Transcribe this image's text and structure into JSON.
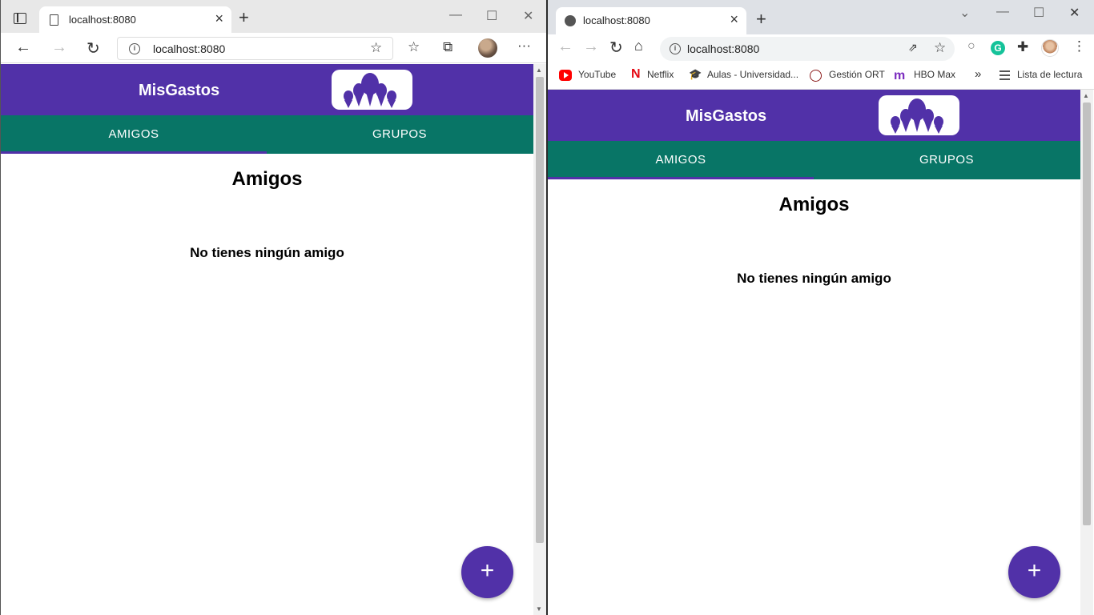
{
  "left_window": {
    "browser": "edge",
    "tab_title": "localhost:8080",
    "address": "localhost:8080",
    "window_controls": {
      "minimize": "—",
      "maximize": "☐",
      "close": "✕"
    }
  },
  "right_window": {
    "browser": "chrome",
    "tab_title": "localhost:8080",
    "address": "localhost:8080",
    "window_controls": {
      "minimize": "—",
      "maximize": "☐",
      "close": "✕",
      "tabsearch": "⌄"
    },
    "bookmarks": [
      {
        "label": "YouTube",
        "icon": "youtube-icon"
      },
      {
        "label": "Netflix",
        "icon": "netflix-icon"
      },
      {
        "label": "Aulas - Universidad...",
        "icon": "graduation-cap-icon"
      },
      {
        "label": "Gestión ORT",
        "icon": "globe-icon"
      },
      {
        "label": "HBO Max",
        "icon": "hbo-icon"
      }
    ],
    "bookmarks_overflow": "»",
    "reading_list": "Lista de lectura"
  },
  "app": {
    "name": "MisGastos",
    "tabs": [
      {
        "label": "AMIGOS",
        "active": true
      },
      {
        "label": "GRUPOS",
        "active": false
      }
    ],
    "heading": "Amigos",
    "empty_message": "No tienes ningún amigo",
    "fab_label": "+"
  },
  "colors": {
    "primary": "#5131a8",
    "tabs": "#087566",
    "white": "#ffffff"
  }
}
